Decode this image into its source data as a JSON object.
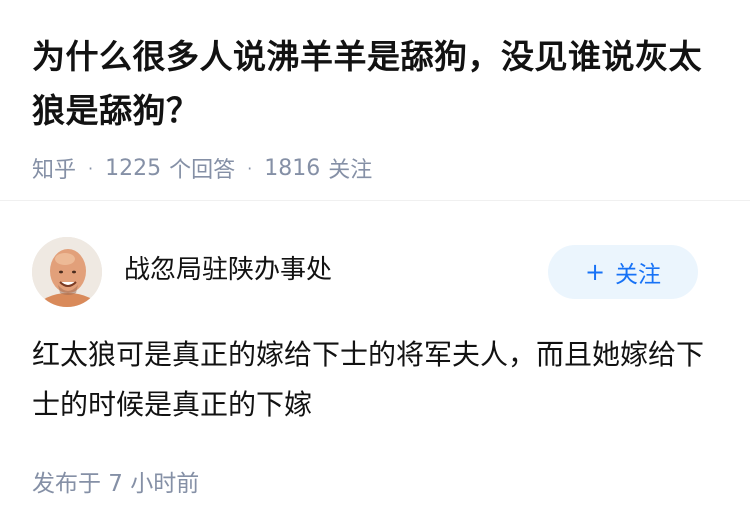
{
  "question": {
    "title": "为什么很多人说沸羊羊是舔狗，没见谁说灰太狼是舔狗？",
    "source": "知乎",
    "answer_count": "1225",
    "answer_label": "个回答",
    "follower_count": "1816",
    "follower_label": "关注",
    "separator": "·"
  },
  "author": {
    "name": "战忽局驻陕办事处",
    "avatar_icon": "avatar-bald-man",
    "follow_plus": "+",
    "follow_label": "关注"
  },
  "answer": {
    "content": "红太狼可是真正的嫁给下士的将军夫人，而且她嫁给下士的时候是真正的下嫁",
    "time": "发布于  7 小时前"
  },
  "colors": {
    "meta_gray": "#8590a6",
    "brand_blue": "#1772f6",
    "button_bg": "#ebf5fd"
  }
}
